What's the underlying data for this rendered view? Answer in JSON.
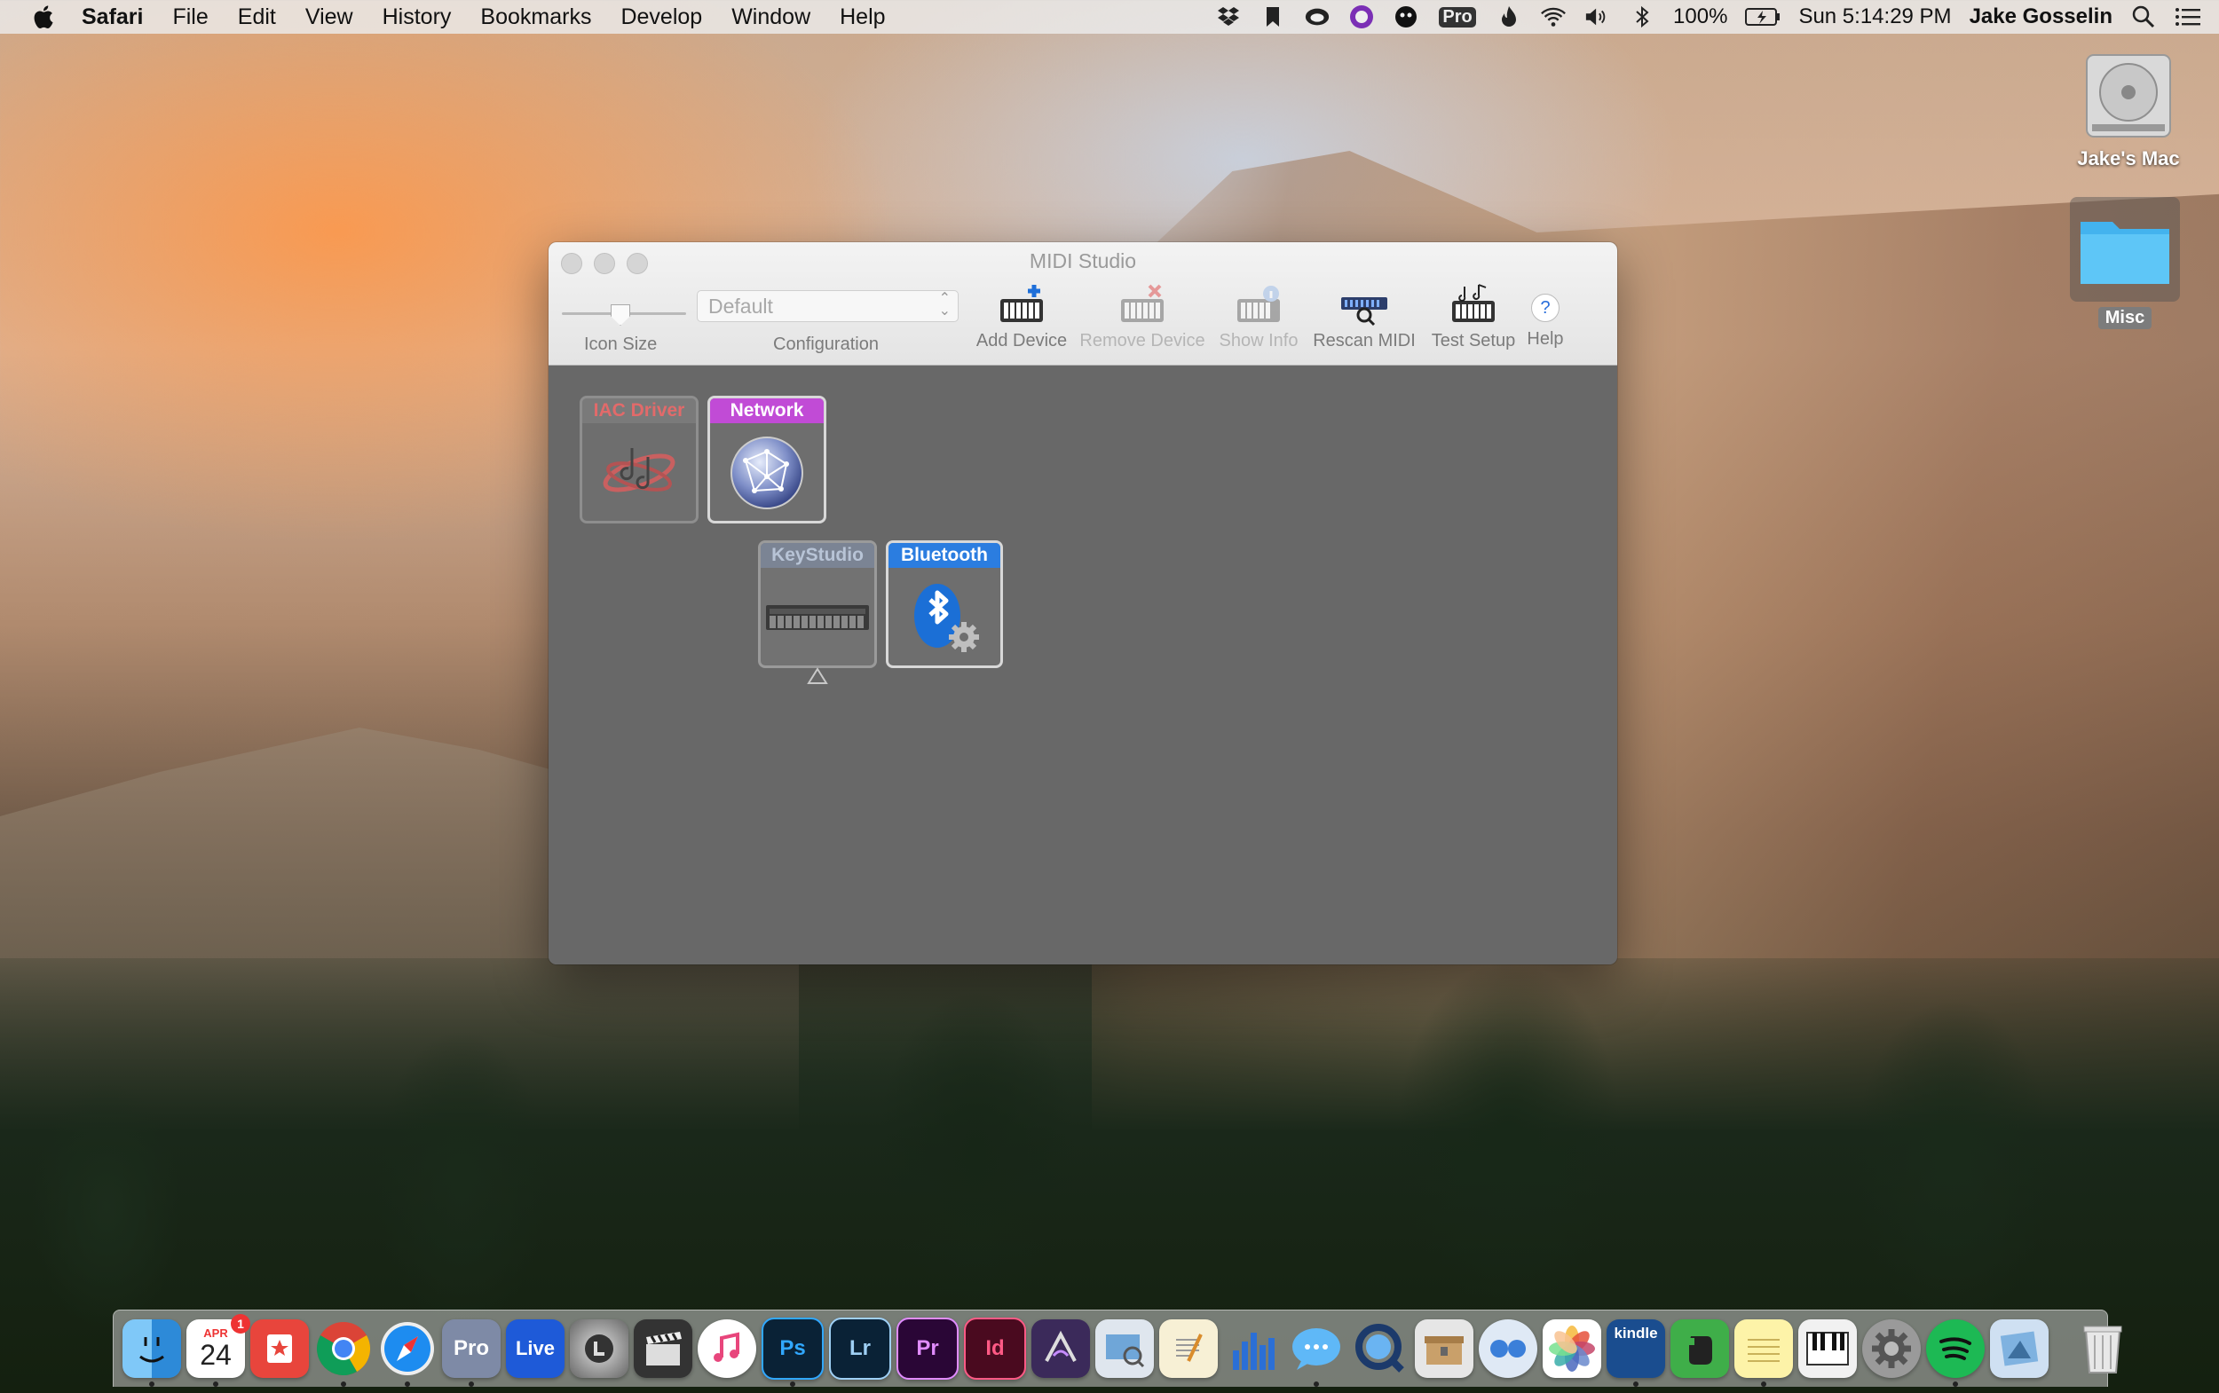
{
  "menubar": {
    "app_name": "Safari",
    "items": [
      "File",
      "Edit",
      "View",
      "History",
      "Bookmarks",
      "Develop",
      "Window",
      "Help"
    ],
    "battery": "100%",
    "clock": "Sun 5:14:29 PM",
    "user": "Jake Gosselin",
    "status_icons": [
      "dropbox-icon",
      "bookmark-icon",
      "creative-cloud-icon",
      "alfred-icon",
      "bartender-icon",
      "istat-pro-icon",
      "flux-icon",
      "wifi-icon",
      "volume-icon",
      "bluetooth-icon",
      "battery-icon",
      "spotlight-icon",
      "notification-center-icon"
    ],
    "pro_badge": "Pro"
  },
  "desktop": {
    "hd_label": "Jake's Mac",
    "folder_label": "Misc"
  },
  "window": {
    "title": "MIDI Studio",
    "toolbar": {
      "icon_size_label": "Icon Size",
      "configuration_label": "Configuration",
      "configuration_value": "Default",
      "add_device": "Add Device",
      "remove_device": "Remove Device",
      "show_info": "Show Info",
      "rescan_midi": "Rescan MIDI",
      "test_setup": "Test Setup",
      "help": "Help",
      "help_glyph": "?"
    },
    "devices": [
      {
        "name": "IAC Driver",
        "color": "#c0504d"
      },
      {
        "name": "Network",
        "color": "#c14bd6"
      },
      {
        "name": "KeyStudio",
        "color": "#8a9ab0"
      },
      {
        "name": "Bluetooth",
        "color": "#2b7de0"
      }
    ]
  },
  "dock": {
    "calendar_month": "APR",
    "calendar_day": "24",
    "calendar_badge": "1",
    "apps": [
      {
        "name": "finder",
        "label": ""
      },
      {
        "name": "calendar",
        "label": ""
      },
      {
        "name": "reeder",
        "label": ""
      },
      {
        "name": "chrome",
        "label": ""
      },
      {
        "name": "safari",
        "label": ""
      },
      {
        "name": "pro-tools",
        "label": "Pro"
      },
      {
        "name": "ableton-live",
        "label": "Live"
      },
      {
        "name": "logic",
        "label": ""
      },
      {
        "name": "final-cut",
        "label": ""
      },
      {
        "name": "itunes",
        "label": ""
      },
      {
        "name": "photoshop",
        "label": "Ps"
      },
      {
        "name": "lightroom",
        "label": "Lr"
      },
      {
        "name": "premiere",
        "label": "Pr"
      },
      {
        "name": "indesign",
        "label": "Id"
      },
      {
        "name": "avid",
        "label": ""
      },
      {
        "name": "preview",
        "label": ""
      },
      {
        "name": "textedit",
        "label": ""
      },
      {
        "name": "istat",
        "label": ""
      },
      {
        "name": "messages",
        "label": ""
      },
      {
        "name": "quicktime",
        "label": ""
      },
      {
        "name": "archive",
        "label": ""
      },
      {
        "name": "flickr",
        "label": ""
      },
      {
        "name": "photos",
        "label": ""
      },
      {
        "name": "kindle",
        "label": "kindle"
      },
      {
        "name": "evernote",
        "label": ""
      },
      {
        "name": "notes",
        "label": ""
      },
      {
        "name": "midi-keyboard",
        "label": ""
      },
      {
        "name": "system-preferences",
        "label": ""
      },
      {
        "name": "spotify",
        "label": ""
      },
      {
        "name": "migration",
        "label": ""
      }
    ]
  }
}
